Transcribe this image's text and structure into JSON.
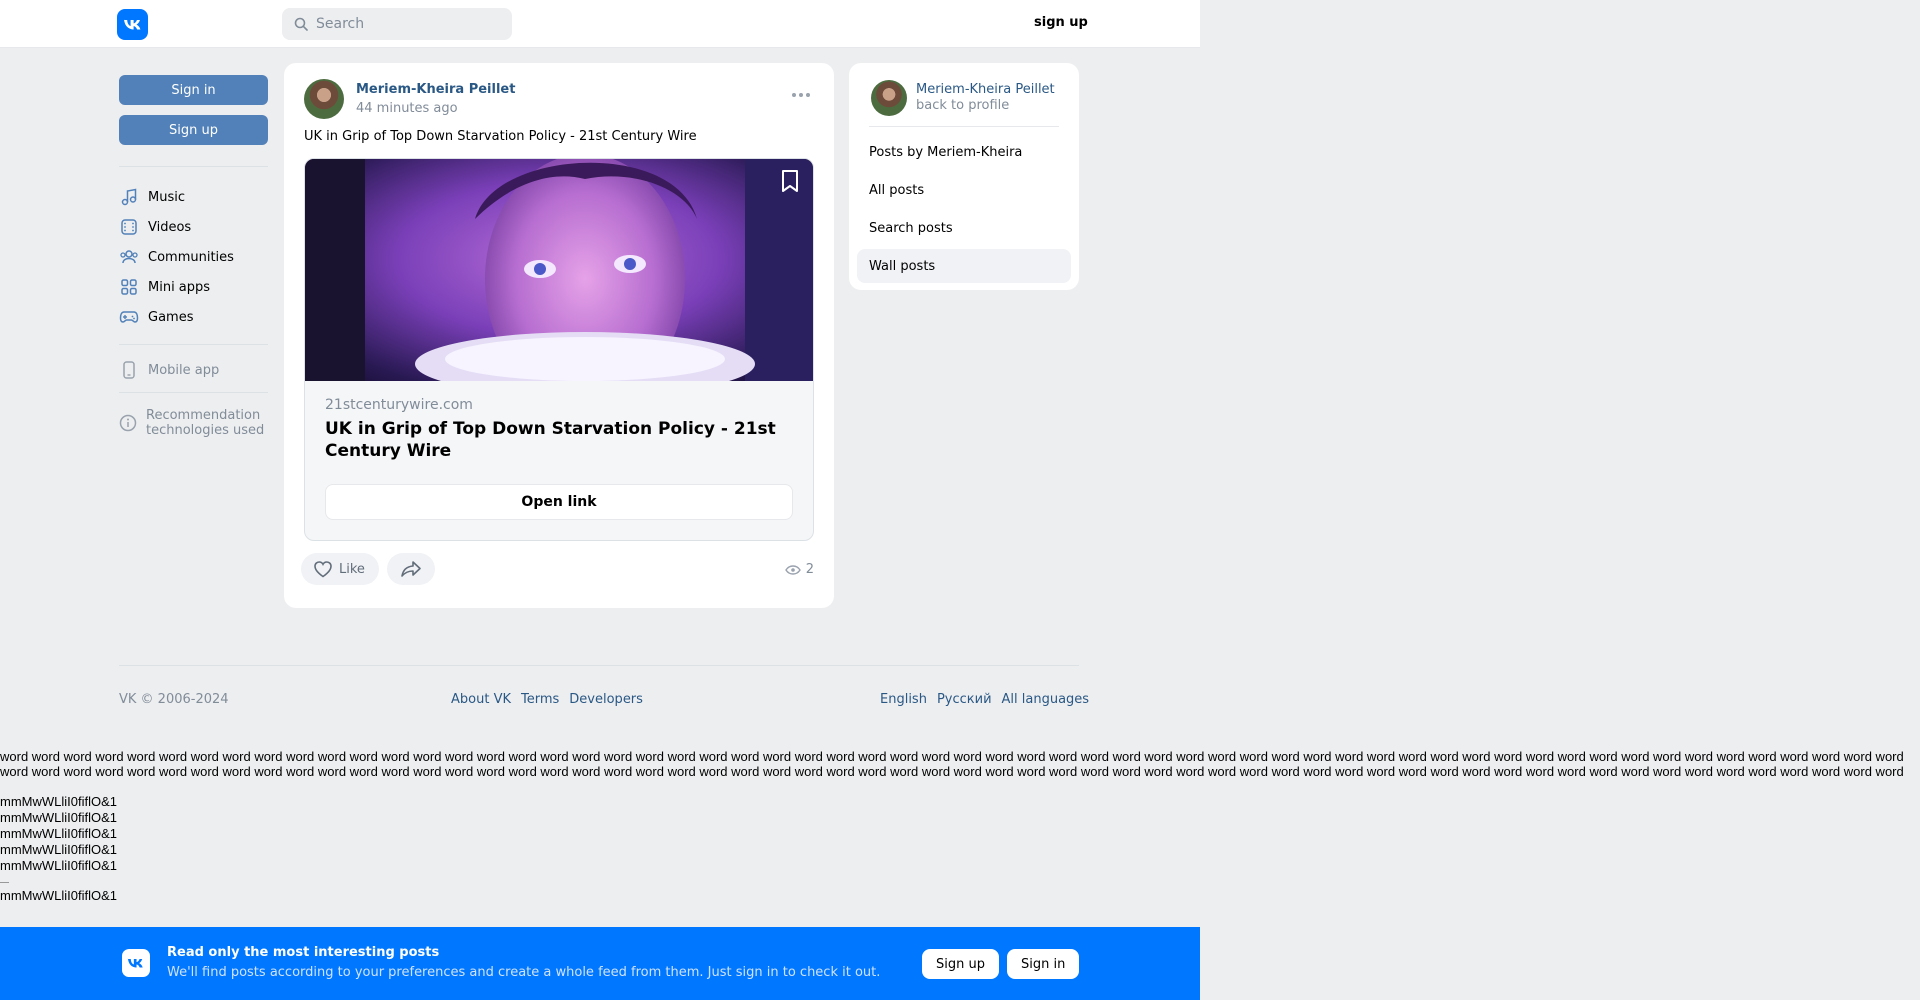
{
  "header": {
    "search_placeholder": "Search",
    "signup_label": "sign up"
  },
  "left_nav": {
    "signin_label": "Sign in",
    "signup_label": "Sign up",
    "items": [
      {
        "label": "Music",
        "icon": "music-icon"
      },
      {
        "label": "Videos",
        "icon": "video-icon"
      },
      {
        "label": "Communities",
        "icon": "communities-icon"
      },
      {
        "label": "Mini apps",
        "icon": "mini-apps-icon"
      },
      {
        "label": "Games",
        "icon": "games-icon"
      }
    ],
    "mobile_app": "Mobile app",
    "recommendation": "Recommendation technologies used"
  },
  "post": {
    "author": "Meriem-Kheira Peillet",
    "time": "44 minutes ago",
    "text": "UK in Grip of Top Down Starvation Policy - 21st Century Wire",
    "link": {
      "domain": "21stcenturywire.com",
      "title": "UK in Grip of Top Down Starvation Policy - 21st Century Wire",
      "button": "Open link"
    },
    "like_label": "Like",
    "views": "2"
  },
  "right_panel": {
    "author": "Meriem-Kheira Peillet",
    "back": "back to profile",
    "items": [
      "Posts by Meriem-Kheira",
      "All posts",
      "Search posts",
      "Wall posts"
    ],
    "active": "Wall posts"
  },
  "footer": {
    "copyright": "VK © 2006-2024",
    "links": [
      "About VK",
      "Terms",
      "Developers"
    ],
    "languages": [
      "English",
      "Русский",
      "All languages"
    ]
  },
  "test_text": {
    "word_line_1": "word word word word word word word word word word word word word word word word word word word word word word word word word word word word word word word word word word word word word word word word word word word word word word word word word word word word word word word word word word word word",
    "word_line_2": "word word word word word word word word word word word word word word word word word word word word word word word word word word word word word word word word word word word word word word word word word word word word word word word word word word word word word word word word word word word word",
    "mm_lines": [
      "mmMwWLliI0fiflO&1",
      "mmMwWLliI0fiflO&1",
      "mmMwWLliI0fiflO&1",
      "mmMwWLliI0fiflO&1",
      "mmMwWLliI0fiflO&1",
      "mmMwWLliI0fiflO&1"
    ]
  },
  "banner": {
    "title": "Read only the most interesting posts",
    "subtitle": "We'll find posts according to your preferences and create a whole feed from them. Just sign in to check it out.",
    "signup_label": "Sign up",
    "signin_label": "Sign in"
  },
  "colors": {
    "brand": "#0077ff",
    "button_blue": "#5181b8",
    "link": "#2a5885",
    "background": "#edeef0"
  }
}
